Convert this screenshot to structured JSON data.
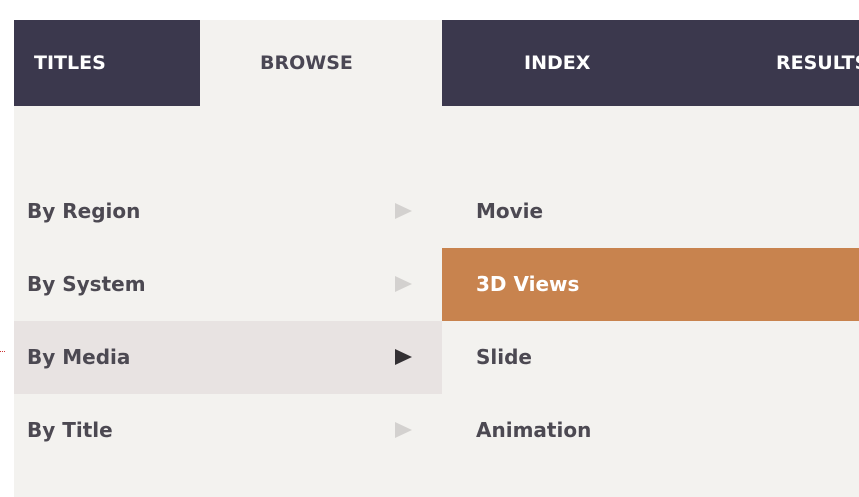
{
  "tabs": [
    {
      "label": "TITLES",
      "active": false
    },
    {
      "label": "BROWSE",
      "active": true
    },
    {
      "label": "INDEX",
      "active": false
    },
    {
      "label": "RESULTS",
      "active": false
    }
  ],
  "browse_menu": {
    "categories": [
      {
        "label": "By Region",
        "selected": false
      },
      {
        "label": "By System",
        "selected": false
      },
      {
        "label": "By Media",
        "selected": true
      },
      {
        "label": "By Title",
        "selected": false
      }
    ],
    "media_options": [
      {
        "label": "Movie",
        "highlighted": false
      },
      {
        "label": "3D Views",
        "highlighted": true
      },
      {
        "label": "Slide",
        "highlighted": false
      },
      {
        "label": "Animation",
        "highlighted": false
      }
    ]
  },
  "colors": {
    "tab_bar": "#3b384d",
    "panel_background": "#f3f2ef",
    "selected_row": "#e8e3e2",
    "highlight": "#c8834e",
    "text": "#4c4952"
  },
  "icons": {
    "submenu_arrow": "triangle-right-icon"
  }
}
